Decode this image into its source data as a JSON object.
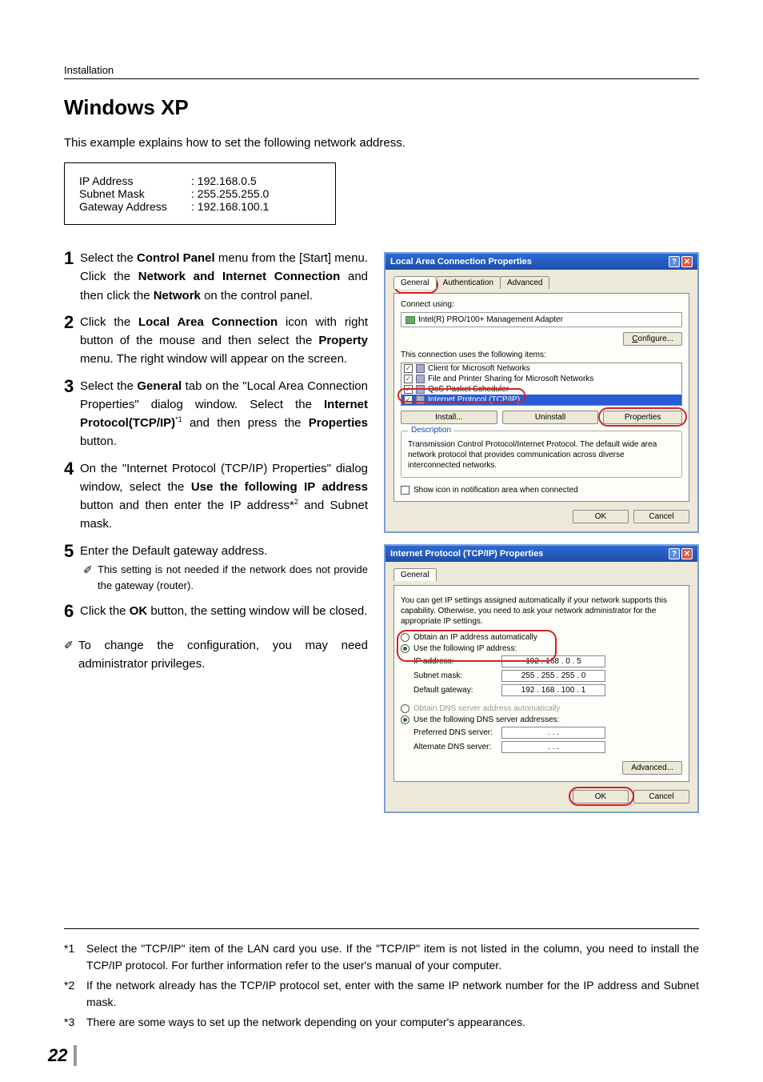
{
  "header": {
    "section": "Installation"
  },
  "title": "Windows XP",
  "intro": "This example explains how to set the following network address.",
  "address_box": {
    "rows": [
      {
        "label": "IP Address",
        "value": "192.168.0.5"
      },
      {
        "label": "Subnet Mask",
        "value": "255.255.255.0"
      },
      {
        "label": "Gateway Address",
        "value": "192.168.100.1"
      }
    ]
  },
  "steps": {
    "s1a": "Select the ",
    "s1b": "Control Panel",
    "s1c": " menu from the [Start] menu. Click the ",
    "s1d": "Network and Internet Connection",
    "s1e": " and then click the ",
    "s1f": "Network",
    "s1g": " on the control panel.",
    "s2a": "Click the ",
    "s2b": "Local Area Connection",
    "s2c": " icon with right button of the mouse and then select the ",
    "s2d": "Property",
    "s2e": " menu. The right window will appear on the screen.",
    "s3a": "Select the ",
    "s3b": "General",
    "s3c": " tab on the \"Local Area Connection Properties\" dialog window. Select the ",
    "s3d": "Internet Protocol(TCP/IP)",
    "s3e": " and then press the ",
    "s3f": "Properties",
    "s3g": " button.",
    "s4a": "On the \"Internet Protocol (TCP/IP) Properties\" dialog window, select the ",
    "s4b": "Use the following IP address",
    "s4c": " button and then enter the IP address*",
    "s4d": " and Subnet mask.",
    "s5a": "Enter the Default gateway address.",
    "s5_note": "This setting is not needed if the network does not provide the gateway (router).",
    "s6a": "Click the ",
    "s6b": "OK",
    "s6c": " button, the setting window will be closed."
  },
  "admin_note": "To change the configuration, you may need administrator privileges.",
  "dialog1": {
    "title": "Local Area Connection Properties",
    "tabs": [
      "General",
      "Authentication",
      "Advanced"
    ],
    "connect_using_label": "Connect using:",
    "adapter": "Intel(R) PRO/100+ Management Adapter",
    "configure": "Configure...",
    "items_label": "This connection uses the following items:",
    "items": [
      "Client for Microsoft Networks",
      "File and Printer Sharing for Microsoft Networks",
      "QoS Packet Scheduler",
      "Internet Protocol (TCP/IP)"
    ],
    "install": "Install...",
    "uninstall": "Uninstall",
    "properties": "Properties",
    "desc_title": "Description",
    "desc_text": "Transmission Control Protocol/Internet Protocol. The default wide area network protocol that provides communication across diverse interconnected networks.",
    "show_icon": "Show icon in notification area when connected",
    "ok": "OK",
    "cancel": "Cancel"
  },
  "dialog2": {
    "title": "Internet Protocol (TCP/IP) Properties",
    "tab": "General",
    "blurb": "You can get IP settings assigned automatically if your network supports this capability. Otherwise, you need to ask your network administrator for the appropriate IP settings.",
    "obtain_auto": "Obtain an IP address automatically",
    "use_following": "Use the following IP address:",
    "ip_label": "IP address:",
    "ip_value": "192 . 168 .   0  .   5",
    "subnet_label": "Subnet mask:",
    "subnet_value": "255 . 255 . 255 .   0",
    "gateway_label": "Default gateway:",
    "gateway_value": "192 . 168 . 100 .   1",
    "dns_auto": "Obtain DNS server address automatically",
    "dns_use": "Use the following DNS server addresses:",
    "pref_dns": "Preferred DNS server:",
    "alt_dns": "Alternate DNS server:",
    "dns_blank": ".       .       .",
    "advanced": "Advanced...",
    "ok": "OK",
    "cancel": "Cancel"
  },
  "footnotes": {
    "f1": "Select the \"TCP/IP\" item of the LAN card you use. If the \"TCP/IP\" item is not listed in the column, you need to install the TCP/IP protocol. For further information refer to the user's manual of your computer.",
    "f2": "If the network already has the TCP/IP protocol set, enter with the same IP network number for the IP address and Subnet mask.",
    "f3": "There are some ways to set up the network depending on your computer's appearances."
  },
  "page_number": "22",
  "superscripts": {
    "s3": "*1",
    "s4": "2"
  },
  "fn_labels": {
    "f1": "*1",
    "f2": "*2",
    "f3": "*3"
  }
}
